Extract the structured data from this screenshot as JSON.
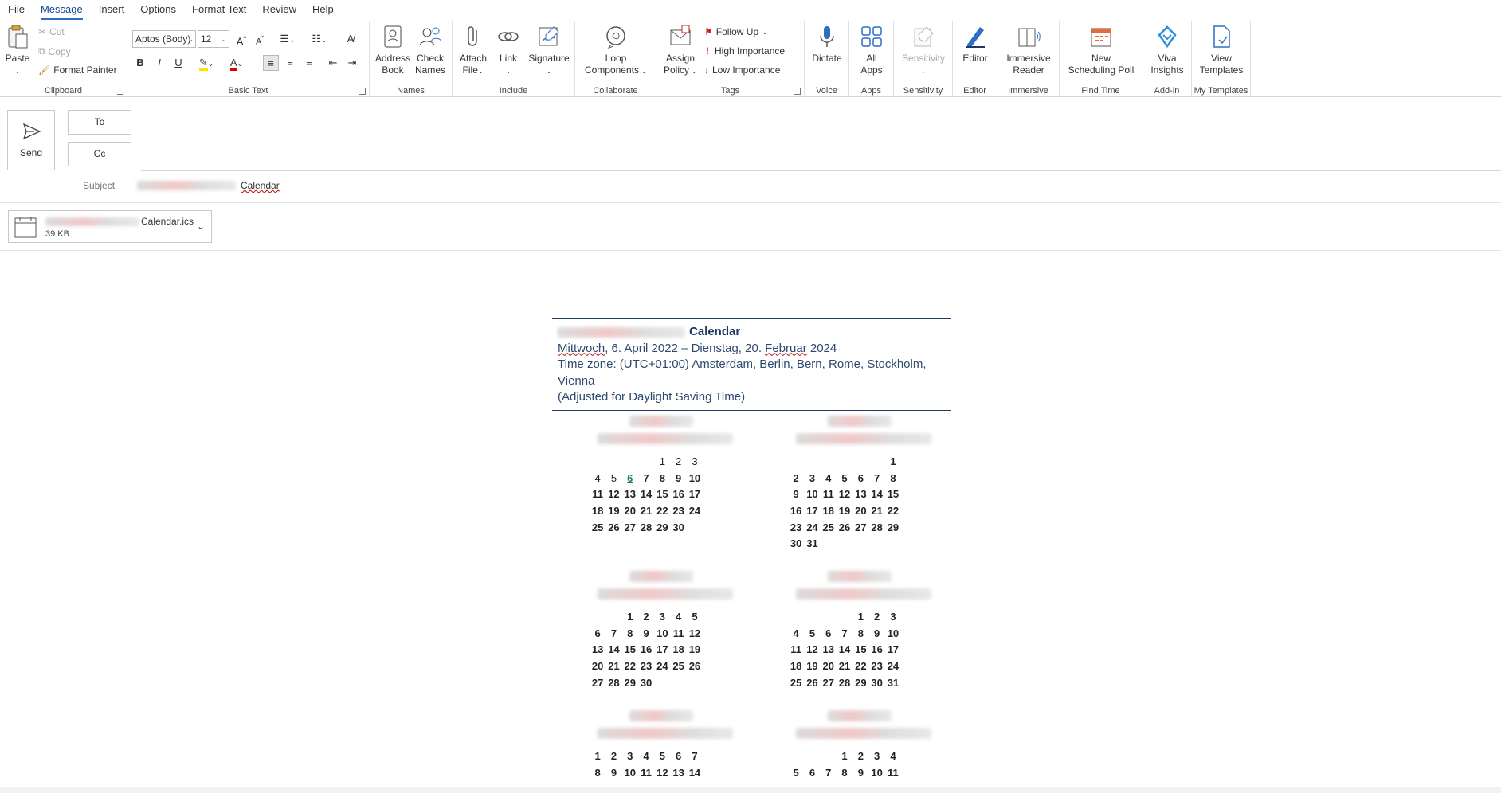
{
  "menu": {
    "tabs": [
      "File",
      "Message",
      "Insert",
      "Options",
      "Format Text",
      "Review",
      "Help"
    ],
    "active": "Message"
  },
  "ribbon": {
    "clipboard": {
      "label": "Clipboard",
      "paste": "Paste",
      "cut": "Cut",
      "copy": "Copy",
      "format_painter": "Format Painter"
    },
    "basic_text": {
      "label": "Basic Text",
      "font": "Aptos (Body)",
      "size": "12",
      "bold": "B",
      "italic": "I",
      "underline": "U",
      "grow": "A",
      "shrink": "A"
    },
    "names": {
      "label": "Names",
      "address_book_1": "Address",
      "address_book_2": "Book",
      "check_names_1": "Check",
      "check_names_2": "Names"
    },
    "include": {
      "label": "Include",
      "attach_1": "Attach",
      "attach_2": "File",
      "link": "Link",
      "signature": "Signature"
    },
    "collaborate": {
      "label": "Collaborate",
      "loop_1": "Loop",
      "loop_2": "Components"
    },
    "tags": {
      "label": "Tags",
      "assign_1": "Assign",
      "assign_2": "Policy",
      "follow_up": "Follow Up",
      "high": "High Importance",
      "low": "Low Importance"
    },
    "voice": {
      "label": "Voice",
      "dictate": "Dictate"
    },
    "apps": {
      "label": "Apps",
      "all_1": "All",
      "all_2": "Apps"
    },
    "sensitivity": {
      "label": "Sensitivity",
      "btn": "Sensitivity"
    },
    "editor": {
      "label": "Editor",
      "btn": "Editor"
    },
    "immersive": {
      "label": "Immersive",
      "btn_1": "Immersive",
      "btn_2": "Reader"
    },
    "find_time": {
      "label": "Find Time",
      "btn_1": "New",
      "btn_2": "Scheduling Poll"
    },
    "addin": {
      "label": "Add-in",
      "btn_1": "Viva",
      "btn_2": "Insights"
    },
    "templates": {
      "label": "My Templates",
      "btn_1": "View",
      "btn_2": "Templates"
    }
  },
  "compose": {
    "send": "Send",
    "to": "To",
    "cc": "Cc",
    "subject_label": "Subject",
    "subject_suffix": "Calendar"
  },
  "attachment": {
    "name_suffix": "Calendar.ics",
    "size": "39 KB"
  },
  "body": {
    "title_suffix": "Calendar",
    "date_range_w1": "Mittwoch",
    "date_range_mid": ", 6. April 2022 – Dienstag, 20. ",
    "date_range_w2": "Februar",
    "date_range_end": " 2024",
    "timezone_1": "Time zone: (UTC+01:00) Amsterdam, Berlin, Bern, Rome, Stockholm,",
    "timezone_2": "Vienna",
    "dst": "(Adjusted for Daylight Saving Time)"
  },
  "months": [
    {
      "offset": 4,
      "days": 30,
      "light_until": 5,
      "today": 6
    },
    {
      "offset": 6,
      "days": 31,
      "light_until": 0,
      "today": 0
    },
    {
      "offset": 2,
      "days": 30,
      "light_until": 0,
      "today": 0
    },
    {
      "offset": 4,
      "days": 31,
      "light_until": 0,
      "today": 0
    },
    {
      "offset": 0,
      "days": 14,
      "light_until": 0,
      "today": 0
    },
    {
      "offset": 3,
      "days": 11,
      "light_until": 0,
      "today": 0
    }
  ],
  "colors": {
    "accent": "#2f6fc3",
    "heading": "#1f3864",
    "body_text": "#2e4a6e",
    "flag_red": "#c42b1c"
  }
}
